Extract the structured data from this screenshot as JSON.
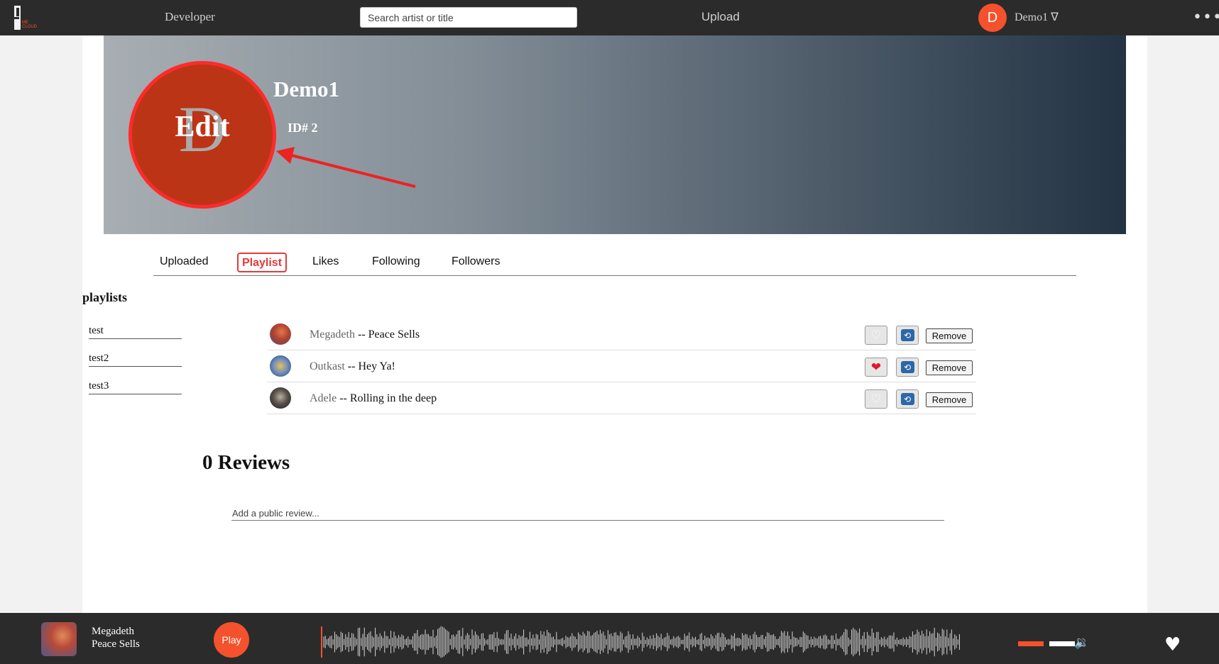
{
  "nav": {
    "developer_label": "Developer",
    "search_placeholder": "Search artist or title",
    "upload_label": "Upload",
    "avatar_initial": "D",
    "user_label": "Demo1 ∇",
    "more_glyph": "•••"
  },
  "profile": {
    "avatar_initial": "D",
    "edit_label": "Edit",
    "name": "Demo1",
    "id_label": "ID# 2"
  },
  "tabs": [
    {
      "label": "Uploaded",
      "active": false
    },
    {
      "label": "Playlist",
      "active": true
    },
    {
      "label": "Likes",
      "active": false
    },
    {
      "label": "Following",
      "active": false
    },
    {
      "label": "Followers",
      "active": false
    }
  ],
  "playlists": {
    "title": "playlists",
    "items": [
      "test",
      "test2",
      "test3"
    ]
  },
  "tracks": [
    {
      "artist": "Megadeth",
      "title": "Peace Sells",
      "liked": false,
      "remove_label": "Remove"
    },
    {
      "artist": "Outkast",
      "title": "Hey Ya!",
      "liked": true,
      "remove_label": "Remove"
    },
    {
      "artist": "Adele",
      "title": "Rolling in the deep",
      "liked": false,
      "remove_label": "Remove"
    }
  ],
  "track_separator": " -- ",
  "reviews": {
    "title": "0 Reviews",
    "placeholder": "Add a public review..."
  },
  "player": {
    "artist": "Megadeth",
    "title": "Peace Sells",
    "play_label": "Play",
    "volume_fraction": 0.5
  },
  "colors": {
    "accent": "#f4512c",
    "active_tab": "#e63a3a",
    "nav_bg": "#2b2b2b",
    "edit_avatar_bg": "#bc3416"
  },
  "icons": {
    "like_off": "♡",
    "like_on": "❤",
    "repost": "⟲",
    "volume": "🔉",
    "player_heart": "♥"
  }
}
